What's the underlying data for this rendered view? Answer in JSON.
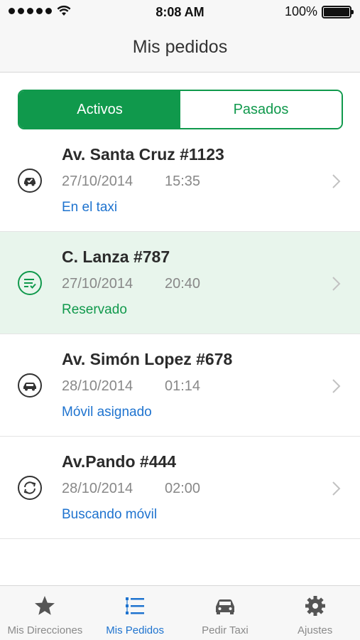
{
  "status_bar": {
    "time": "8:08 AM",
    "battery_text": "100%",
    "battery_level": 1.0
  },
  "nav": {
    "title": "Mis pedidos"
  },
  "segments": {
    "active_label": "Activos",
    "inactive_label": "Pasados"
  },
  "orders": [
    {
      "address": "Av. Santa Cruz #1123",
      "date": "27/10/2014",
      "time": "15:35",
      "status": "En el taxi",
      "status_color": "#1e73cf",
      "icon": "taxi-check-icon",
      "highlighted": false
    },
    {
      "address": "C. Lanza #787",
      "date": "27/10/2014",
      "time": "20:40",
      "status": "Reservado",
      "status_color": "#10994c",
      "icon": "reserved-list-icon",
      "highlighted": true
    },
    {
      "address": "Av. Simón Lopez #678",
      "date": "28/10/2014",
      "time": "01:14",
      "status": "Móvil asignado",
      "status_color": "#1e73cf",
      "icon": "taxi-icon",
      "highlighted": false
    },
    {
      "address": "Av.Pando #444",
      "date": "28/10/2014",
      "time": "02:00",
      "status": "Buscando móvil",
      "status_color": "#1e73cf",
      "icon": "searching-refresh-icon",
      "highlighted": false
    }
  ],
  "tabs": [
    {
      "label": "Mis Direcciones",
      "icon": "star-icon",
      "active": false
    },
    {
      "label": "Mis Pedidos",
      "icon": "list-icon",
      "active": true
    },
    {
      "label": "Pedir Taxi",
      "icon": "car-icon",
      "active": false
    },
    {
      "label": "Ajustes",
      "icon": "gear-icon",
      "active": false
    }
  ],
  "colors": {
    "green": "#10994c",
    "blue": "#1e73cf",
    "highlight_bg": "#e8f5ec"
  }
}
